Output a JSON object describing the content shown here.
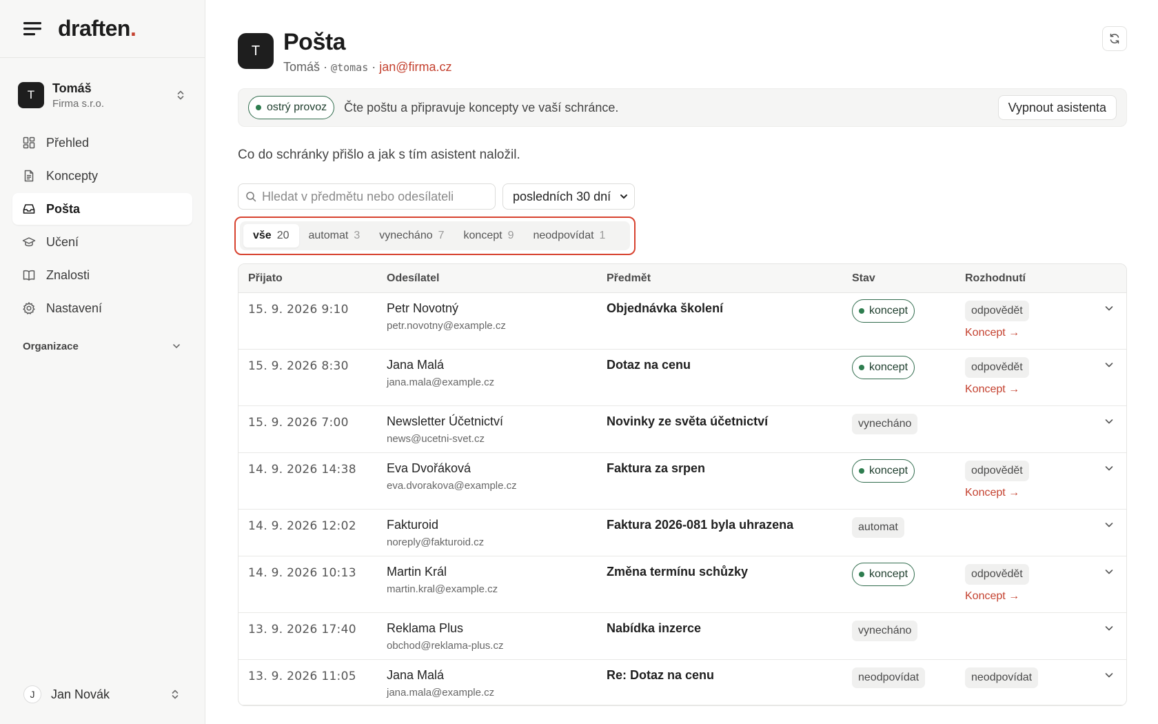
{
  "brand": {
    "name": "draften",
    "dot": "."
  },
  "account": {
    "initial": "T",
    "name": "Tomáš",
    "org": "Firma s.r.o."
  },
  "nav": [
    {
      "label": "Přehled",
      "icon": "dashboard-icon",
      "active": false
    },
    {
      "label": "Koncepty",
      "icon": "document-icon",
      "active": false
    },
    {
      "label": "Pošta",
      "icon": "inbox-icon",
      "active": true
    },
    {
      "label": "Učení",
      "icon": "graduation-cap-icon",
      "active": false
    },
    {
      "label": "Znalosti",
      "icon": "book-icon",
      "active": false
    },
    {
      "label": "Nastavení",
      "icon": "gear-icon",
      "active": false
    }
  ],
  "organization_label": "Organizace",
  "user": {
    "initial": "J",
    "name": "Jan Novák"
  },
  "header": {
    "initial": "T",
    "title": "Pošta",
    "name": "Tomáš",
    "handle": "@tomas",
    "email": "jan@firma.cz",
    "sep": "·"
  },
  "banner": {
    "status": "ostrý provoz",
    "text": "Čte poštu a připravuje koncepty ve vaší schránce.",
    "button": "Vypnout asistenta"
  },
  "intro": "Co do schránky přišlo a jak s tím asistent naložil.",
  "search": {
    "placeholder": "Hledat v předmětu nebo odesílateli",
    "value": ""
  },
  "period": {
    "selected": "posledních 30 dní"
  },
  "filters": [
    {
      "label": "vše",
      "count": "20",
      "active": true
    },
    {
      "label": "automat",
      "count": "3",
      "active": false
    },
    {
      "label": "vynecháno",
      "count": "7",
      "active": false
    },
    {
      "label": "koncept",
      "count": "9",
      "active": false
    },
    {
      "label": "neodpovídat",
      "count": "1",
      "active": false
    }
  ],
  "table": {
    "headers": [
      "Přijato",
      "Odesílatel",
      "Předmět",
      "Stav",
      "Rozhodnutí"
    ],
    "rows": [
      {
        "date": "15. 9. 2026 9:10",
        "sender": "Petr Novotný",
        "email": "petr.novotny@example.cz",
        "subject": "Objednávka školení",
        "status": "koncept",
        "decision": "odpovědět",
        "link": "Koncept →"
      },
      {
        "date": "15. 9. 2026 8:30",
        "sender": "Jana Malá",
        "email": "jana.mala@example.cz",
        "subject": "Dotaz na cenu",
        "status": "koncept",
        "decision": "odpovědět",
        "link": "Koncept →"
      },
      {
        "date": "15. 9. 2026 7:00",
        "sender": "Newsletter Účetnictví",
        "email": "news@ucetni-svet.cz",
        "subject": "Novinky ze světa účetnictví",
        "status": "vynecháno",
        "decision": "",
        "link": ""
      },
      {
        "date": "14. 9. 2026 14:38",
        "sender": "Eva Dvořáková",
        "email": "eva.dvorakova@example.cz",
        "subject": "Faktura za srpen",
        "status": "koncept",
        "decision": "odpovědět",
        "link": "Koncept →"
      },
      {
        "date": "14. 9. 2026 12:02",
        "sender": "Fakturoid",
        "email": "noreply@fakturoid.cz",
        "subject": "Faktura 2026-081 byla uhrazena",
        "status": "automat",
        "decision": "",
        "link": ""
      },
      {
        "date": "14. 9. 2026 10:13",
        "sender": "Martin Král",
        "email": "martin.kral@example.cz",
        "subject": "Změna termínu schůzky",
        "status": "koncept",
        "decision": "odpovědět",
        "link": "Koncept →"
      },
      {
        "date": "13. 9. 2026 17:40",
        "sender": "Reklama Plus",
        "email": "obchod@reklama-plus.cz",
        "subject": "Nabídka inzerce",
        "status": "vynecháno",
        "decision": "",
        "link": ""
      },
      {
        "date": "13. 9. 2026 11:05",
        "sender": "Jana Malá",
        "email": "jana.mala@example.cz",
        "subject": "Re: Dotaz na cenu",
        "status": "neodpovídat",
        "decision": "neodpovídat",
        "link": ""
      }
    ]
  },
  "colors": {
    "accent": "#c4412f",
    "live_green": "#2e7d4f",
    "highlight_border": "#d7412e"
  }
}
